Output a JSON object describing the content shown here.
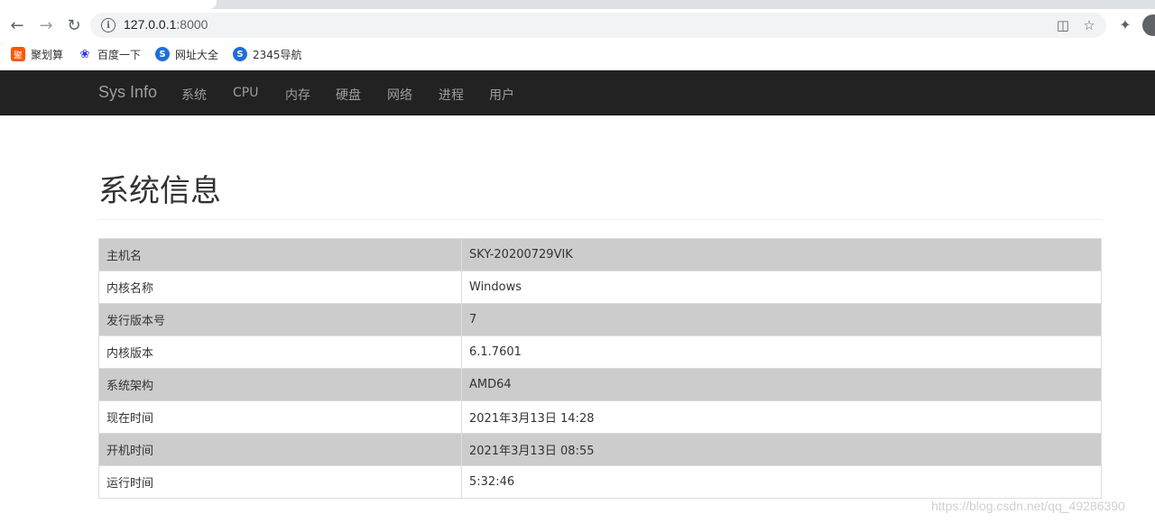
{
  "browser": {
    "url_host": "127.0.0.1",
    "url_port": ":8000",
    "bookmarks": [
      {
        "label": "聚划算",
        "icon": "juhuasuan-icon",
        "color": "#ff5500"
      },
      {
        "label": "百度一下",
        "icon": "baidu-paw-icon",
        "color": "#2932e1"
      },
      {
        "label": "网址大全",
        "icon": "sogou-s-icon",
        "color": "#1e6fd9"
      },
      {
        "label": "2345导航",
        "icon": "sogou-s-icon",
        "color": "#1e6fd9"
      }
    ]
  },
  "navbar": {
    "brand": "Sys Info",
    "items": [
      {
        "label": "系统"
      },
      {
        "label": "CPU"
      },
      {
        "label": "内存"
      },
      {
        "label": "硬盘"
      },
      {
        "label": "网络"
      },
      {
        "label": "进程"
      },
      {
        "label": "用户"
      }
    ]
  },
  "main": {
    "title": "系统信息",
    "rows": [
      {
        "key": "主机名",
        "value": "SKY-20200729VIK"
      },
      {
        "key": "内核名称",
        "value": "Windows"
      },
      {
        "key": "发行版本号",
        "value": "7"
      },
      {
        "key": "内核版本",
        "value": "6.1.7601"
      },
      {
        "key": "系统架构",
        "value": "AMD64"
      },
      {
        "key": "现在时间",
        "value": "2021年3月13日 14:28"
      },
      {
        "key": "开机时间",
        "value": "2021年3月13日 08:55"
      },
      {
        "key": "运行时间",
        "value": "5:32:46"
      }
    ]
  },
  "watermark": "https://blog.csdn.net/qq_49286390",
  "colors": {
    "navbar_bg": "#222222",
    "navbar_text": "#9d9d9d",
    "row_shade": "#cccccc"
  }
}
